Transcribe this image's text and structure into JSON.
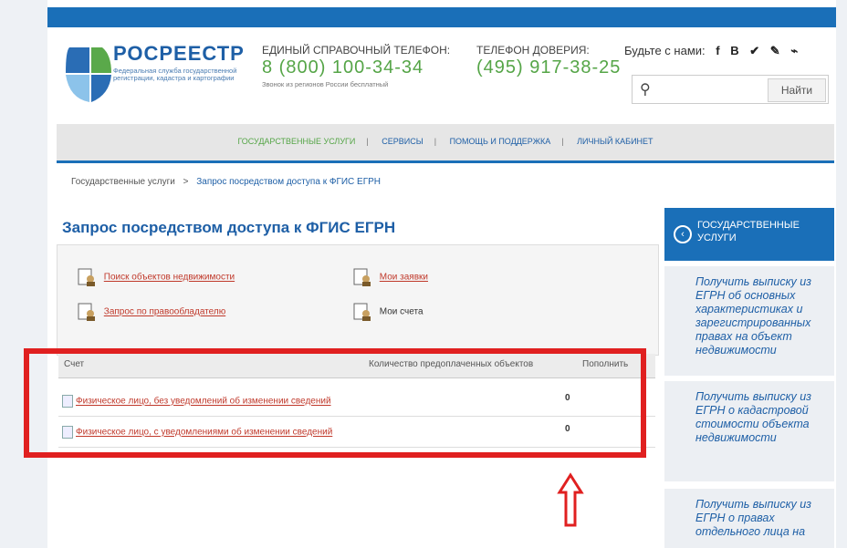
{
  "brand": {
    "title": "РОСРЕЕСТР",
    "subtitle": "Федеральная служба государственной регистрации, кадастра и картографии"
  },
  "phones": [
    {
      "label": "ЕДИНЫЙ СПРАВОЧНЫЙ ТЕЛЕФОН:",
      "number": "8 (800) 100-34-34",
      "note": "Звонок из регионов России бесплатный"
    },
    {
      "label": "ТЕЛЕФОН ДОВЕРИЯ:",
      "number": "(495) 917-38-25"
    }
  ],
  "social": {
    "label": "Будьте с нами:",
    "icons": [
      "f",
      "B",
      "✔",
      "✎",
      "⌁"
    ]
  },
  "search": {
    "placeholder": "",
    "button": "Найти"
  },
  "menu": [
    "ГОСУДАРСТВЕННЫЕ УСЛУГИ",
    "СЕРВИСЫ",
    "ПОМОЩЬ И ПОДДЕРЖКА",
    "ЛИЧНЫЙ КАБИНЕТ"
  ],
  "breadcrumb": {
    "root": "Государственные услуги",
    "sep": ">",
    "current": "Запрос посредством доступа к ФГИС ЕГРН"
  },
  "page_title": "Запрос посредством доступа к ФГИС ЕГРН",
  "links": {
    "search_objects": "Поиск объектов недвижимости",
    "my_requests": "Мои заявки",
    "by_owner": "Запрос по правообладателю",
    "my_accounts": "Мои счета"
  },
  "table": {
    "headers": [
      "Счет",
      "Количество предоплаченных объектов",
      "Пополнить"
    ],
    "rows": [
      {
        "name": "Физическое лицо, без уведомлений об изменении сведений",
        "qty": "0"
      },
      {
        "name": "Физическое лицо, с уведомлениями об изменении сведений",
        "qty": "0"
      }
    ]
  },
  "sidebar": {
    "heading": "ГОСУДАРСТВЕННЫЕ УСЛУГИ",
    "items": [
      "Получить выписку из ЕГРН об основных характеристиках и зарегистрированных правах на объект недвижимости",
      "Получить выписку из ЕГРН о кадастровой стоимости объекта недвижимости",
      "Получить выписку из ЕГРН о правах отдельного лица на"
    ]
  },
  "colors": {
    "brand_blue": "#1a6fb8",
    "phone_green": "#55a547",
    "link_red": "#c0392b",
    "highlight_red": "#e02020"
  }
}
